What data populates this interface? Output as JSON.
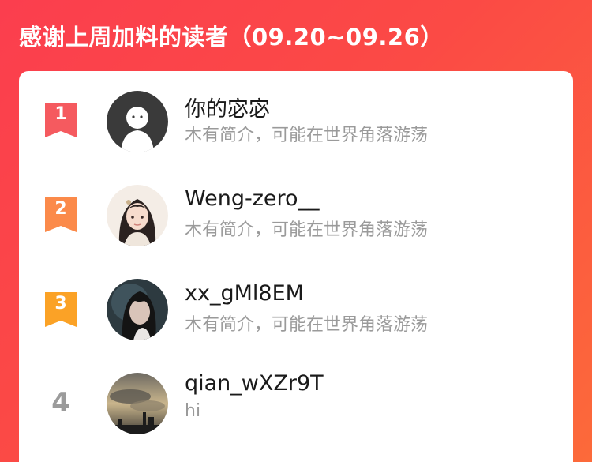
{
  "header": {
    "title": "感谢上周加料的读者（09.20~09.26）"
  },
  "colors": {
    "rank1": "#f55a5f",
    "rank2": "#fb8a4a",
    "rank3": "#fba226",
    "background": "#fb4547"
  },
  "readers": [
    {
      "rank": "1",
      "name": "你的宓宓",
      "bio": "木有简介，可能在世界角落游荡",
      "avatar": "default-ghost-avatar"
    },
    {
      "rank": "2",
      "name": "Weng-zero__",
      "bio": "木有简介，可能在世界角落游荡",
      "avatar": "illustrated-girl-avatar"
    },
    {
      "rank": "3",
      "name": "xx_gMl8EM",
      "bio": "木有简介，可能在世界角落游荡",
      "avatar": "photo-portrait-avatar"
    },
    {
      "rank": "4",
      "name": "qian_wXZr9T",
      "bio": "hi",
      "avatar": "cloudy-sky-avatar"
    }
  ]
}
